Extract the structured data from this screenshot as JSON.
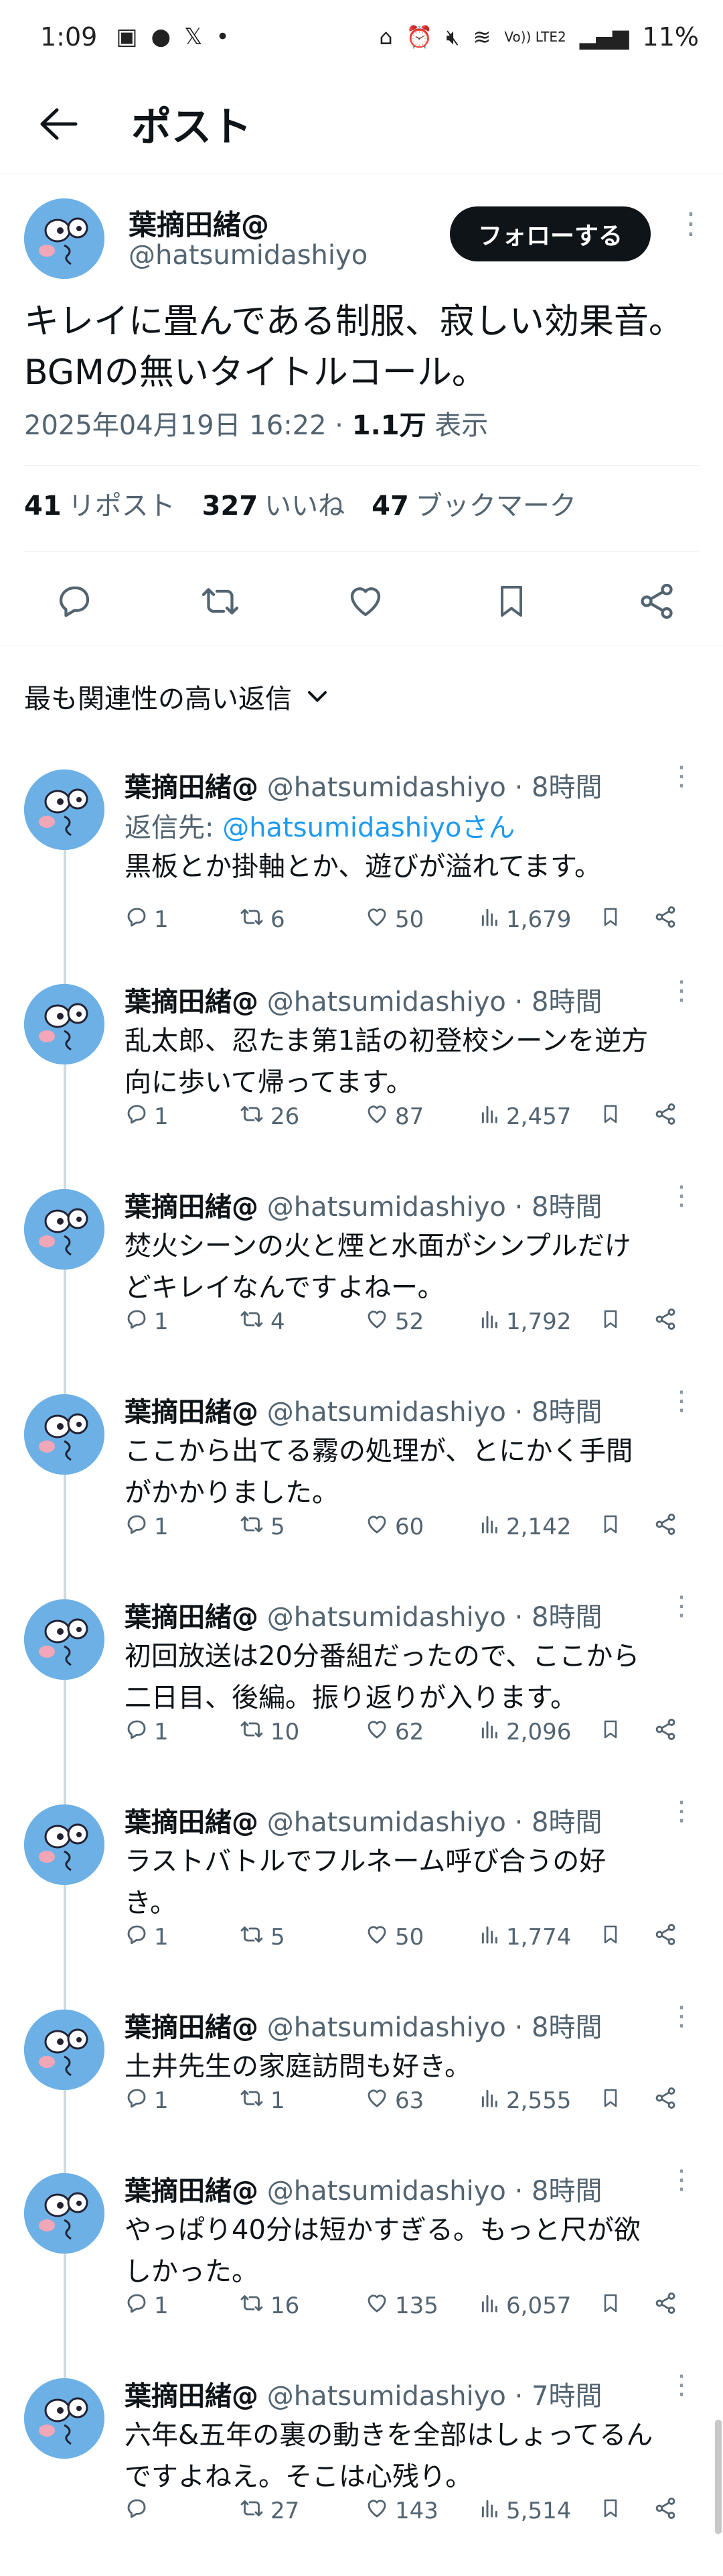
{
  "status": {
    "time": "1:09",
    "network": "Vo)) LTE2",
    "battery": "11%"
  },
  "header": {
    "title": "ポスト"
  },
  "post": {
    "author_name": "葉摘田緒@",
    "handle": "@hatsumidashiyo",
    "follow_label": "フォローする",
    "text_line1": "キレイに畳んである制服、寂しい効果音。",
    "text_line2": "BGMの無いタイトルコール。",
    "date": "2025年04月19日 16:22 · ",
    "views_count": "1.1万",
    "views_label": " 表示",
    "reposts_count": "41",
    "reposts_label": "リポスト",
    "likes_count": "327",
    "likes_label": "いいね",
    "bookmarks_count": "47",
    "bookmarks_label": "ブックマーク"
  },
  "sort": {
    "label": "最も関連性の高い返信"
  },
  "replies": [
    {
      "name": "葉摘田緒@",
      "handle": "@hatsumidashiyo · 8時間",
      "reply_to_prefix": "返信先: ",
      "reply_to": "@hatsumidashiyoさん",
      "line1": "黒板とか掛軸とか、遊びが溢れてます。",
      "line2": "",
      "replies": "1",
      "reposts": "6",
      "likes": "50",
      "views": "1,679"
    },
    {
      "name": "葉摘田緒@",
      "handle": "@hatsumidashiyo · 8時間",
      "line1": "乱太郎、忍たま第1話の初登校シーンを逆方",
      "line2": "向に歩いて帰ってます。",
      "replies": "1",
      "reposts": "26",
      "likes": "87",
      "views": "2,457"
    },
    {
      "name": "葉摘田緒@",
      "handle": "@hatsumidashiyo · 8時間",
      "line1": "焚火シーンの火と煙と水面がシンプルだけ",
      "line2": "どキレイなんですよねー。",
      "replies": "1",
      "reposts": "4",
      "likes": "52",
      "views": "1,792"
    },
    {
      "name": "葉摘田緒@",
      "handle": "@hatsumidashiyo · 8時間",
      "line1": "ここから出てる霧の処理が、とにかく手間",
      "line2": "がかかりました。",
      "replies": "1",
      "reposts": "5",
      "likes": "60",
      "views": "2,142"
    },
    {
      "name": "葉摘田緒@",
      "handle": "@hatsumidashiyo · 8時間",
      "line1": "初回放送は20分番組だったので、ここから",
      "line2": "二日目、後編。振り返りが入ります。",
      "replies": "1",
      "reposts": "10",
      "likes": "62",
      "views": "2,096"
    },
    {
      "name": "葉摘田緒@",
      "handle": "@hatsumidashiyo · 8時間",
      "line1": "ラストバトルでフルネーム呼び合うの好",
      "line2": "き。",
      "replies": "1",
      "reposts": "5",
      "likes": "50",
      "views": "1,774"
    },
    {
      "name": "葉摘田緒@",
      "handle": "@hatsumidashiyo · 8時間",
      "line1": "土井先生の家庭訪問も好き。",
      "line2": "",
      "replies": "1",
      "reposts": "1",
      "likes": "63",
      "views": "2,555"
    },
    {
      "name": "葉摘田緒@",
      "handle": "@hatsumidashiyo · 8時間",
      "line1": "やっぱり40分は短かすぎる。もっと尺が欲",
      "line2": "しかった。",
      "replies": "1",
      "reposts": "16",
      "likes": "135",
      "views": "6,057"
    },
    {
      "name": "葉摘田緒@",
      "handle": "@hatsumidashiyo · 7時間",
      "line1": "六年&五年の裏の動きを全部はしょってるん",
      "line2": "ですよねえ。そこは心残り。",
      "replies": "",
      "reposts": "27",
      "likes": "143",
      "views": "5,514"
    }
  ]
}
